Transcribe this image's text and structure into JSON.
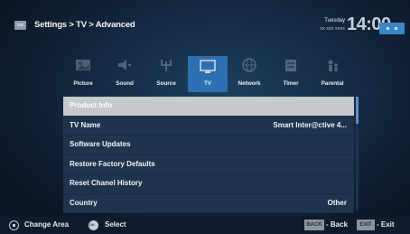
{
  "header": {
    "breadcrumb": "Settings > TV > Advanced",
    "day": "Tuesday",
    "date": "xx xxx xxxx",
    "clock": "14:00"
  },
  "tabs": [
    {
      "label": "Picture",
      "icon": "picture-icon",
      "active": false
    },
    {
      "label": "Sound",
      "icon": "speaker-icon",
      "active": false
    },
    {
      "label": "Source",
      "icon": "antenna-icon",
      "active": false
    },
    {
      "label": "TV",
      "icon": "tv-icon",
      "active": true
    },
    {
      "label": "Network",
      "icon": "globe-icon",
      "active": false
    },
    {
      "label": "Timer",
      "icon": "timer-icon",
      "active": false
    },
    {
      "label": "Parental",
      "icon": "parental-icon",
      "active": false
    }
  ],
  "menu": [
    {
      "label": "Product Info",
      "value": "",
      "selected": true
    },
    {
      "label": "TV Name",
      "value": "Smart Inter@ctive 4...",
      "selected": false
    },
    {
      "label": "Software Updates",
      "value": "",
      "selected": false
    },
    {
      "label": "Restore Factory Defaults",
      "value": "",
      "selected": false
    },
    {
      "label": "Reset Chanel History",
      "value": "",
      "selected": false
    },
    {
      "label": "Country",
      "value": "Other",
      "selected": false
    }
  ],
  "footer": {
    "change_area": "Change Area",
    "select": "Select",
    "back_key": "BACK",
    "back": "- Back",
    "exit_key": "EXIT",
    "exit": "- Exit"
  },
  "colors": {
    "accent": "#2d6fb0",
    "selected_row": "#c6c8cb",
    "row": "#1e344d"
  }
}
